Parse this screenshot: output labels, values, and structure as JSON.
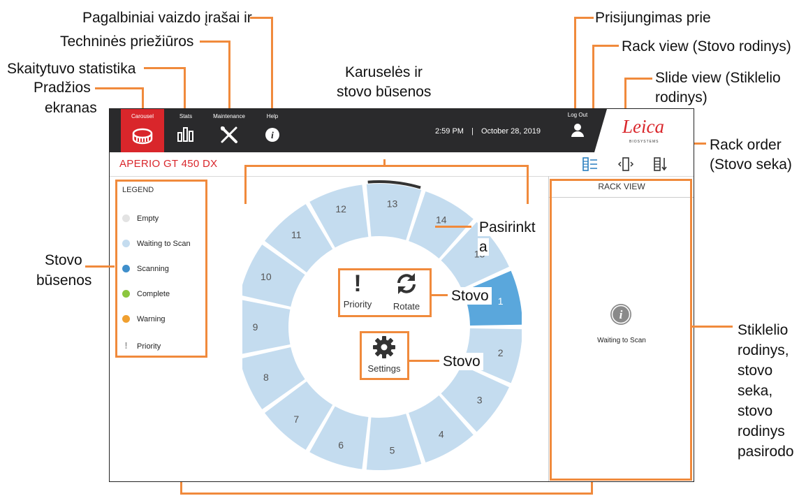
{
  "app": {
    "nav": [
      {
        "label": "Carousel",
        "icon": "carousel-icon"
      },
      {
        "label": "Stats",
        "icon": "stats-icon"
      },
      {
        "label": "Maintenance",
        "icon": "maintenance-icon"
      },
      {
        "label": "Help",
        "icon": "help-icon"
      }
    ],
    "time": "2:59 PM",
    "separator": "|",
    "date": "October 28, 2019",
    "logout_label": "Log Out",
    "logo_text": "Leica",
    "logo_sub": "BIOSYSTEMS",
    "product": "APERIO GT 450 DX",
    "view_icons": [
      "rack-view-icon",
      "slide-view-icon",
      "rack-order-icon"
    ],
    "legend": {
      "title": "LEGEND",
      "items": [
        {
          "label": "Empty",
          "color": "#e3e3e3"
        },
        {
          "label": "Waiting to Scan",
          "color": "#c4dcef"
        },
        {
          "label": "Scanning",
          "color": "#3f8fcb"
        },
        {
          "label": "Complete",
          "color": "#8cc63f"
        },
        {
          "label": "Warning",
          "color": "#f0a030"
        },
        {
          "label": "Priority",
          "color": "#9a9a9a"
        }
      ]
    },
    "carousel_slots": [
      "1",
      "2",
      "3",
      "4",
      "5",
      "6",
      "7",
      "8",
      "9",
      "10",
      "11",
      "12",
      "13",
      "14",
      "15"
    ],
    "priority_label": "Priority",
    "rotate_label": "Rotate",
    "settings_label": "Settings",
    "rack_view": {
      "header": "RACK VIEW",
      "status": "Waiting to Scan"
    },
    "colors": {
      "accent": "#d9262b",
      "slot": "#c4dcef",
      "active_slot": "#5aa7dc",
      "callout": "#f08a3c"
    }
  },
  "callouts": {
    "help": "Pagalbiniai vaizdo įrašai ir",
    "maintenance": "Techninės priežiūros",
    "stats": "Skaitytuvo statistika",
    "home_1": "Pradžios",
    "home_2": "ekranas",
    "carousel_1": "Karuselės ir",
    "carousel_2": "stovo būsenos",
    "login": "Prisijungimas prie",
    "rackview": "Rack view (Stovo rodinys)",
    "slideview_1": "Slide view (Stiklelio",
    "slideview_2": "rodinys)",
    "rackorder_1": "Rack order",
    "rackorder_2": "(Stovo seka)",
    "selected_1": "Pasirinkt",
    "selected_2": "a",
    "rack_status_1": "Stovo",
    "rack_status_2": "būsenos",
    "rack_1": "Stovo",
    "rack_2": "Stovo",
    "right_lines": [
      "Stiklelio",
      "rodinys,",
      "stovo",
      "seka,",
      "stovo",
      "rodinys",
      "pasirodo"
    ]
  }
}
